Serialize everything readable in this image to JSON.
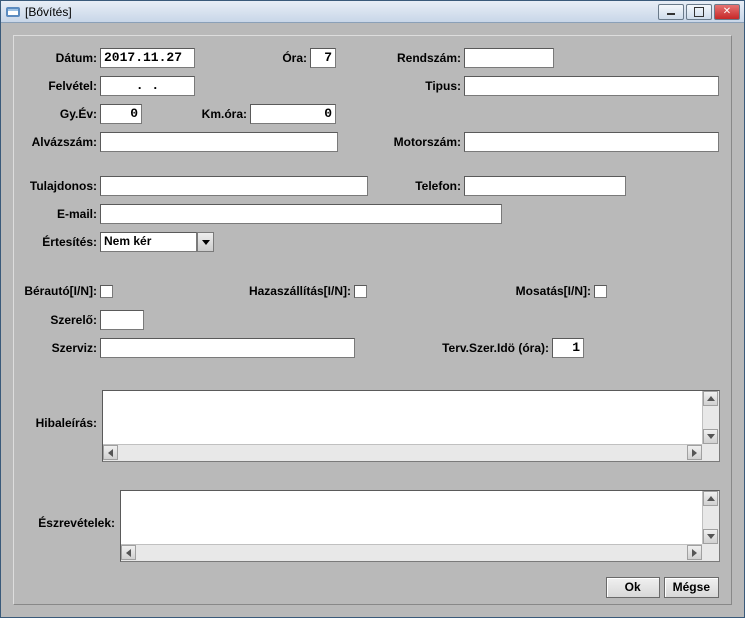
{
  "window": {
    "title": "[Bővítés]"
  },
  "labels": {
    "datum": "Dátum:",
    "ora": "Óra:",
    "rendszam": "Rendszám:",
    "felvetel": "Felvétel:",
    "tipus": "Tipus:",
    "gyev": "Gy.Év:",
    "kmora": "Km.óra:",
    "alvazszam": "Alvázszám:",
    "motorszam": "Motorszám:",
    "tulajdonos": "Tulajdonos:",
    "telefon": "Telefon:",
    "email": "E-mail:",
    "ertesites": "Értesítés:",
    "berauto": "Bérautó[I/N]:",
    "hazaszallitas": "Hazaszállítás[I/N]:",
    "mosatas": "Mosatás[I/N]:",
    "szerelo": "Szerelő:",
    "szerviz": "Szerviz:",
    "tervszerido": "Terv.Szer.Idö (óra):",
    "hibaleiras": "Hibaleírás:",
    "eszrevetelek": "Észrevételek:"
  },
  "values": {
    "datum": "2017.11.27",
    "ora": "7",
    "rendszam": "",
    "felvetel": ".  .",
    "tipus": "",
    "gyev": "0",
    "kmora": "0",
    "alvazszam": "",
    "motorszam": "",
    "tulajdonos": "",
    "telefon": "",
    "email": "",
    "ertesites": "Nem kér",
    "szerelo": "",
    "szerviz": "",
    "tervszerido": "1",
    "hibaleiras": "",
    "eszrevetelek": ""
  },
  "buttons": {
    "ok": "Ok",
    "cancel": "Mégse"
  }
}
